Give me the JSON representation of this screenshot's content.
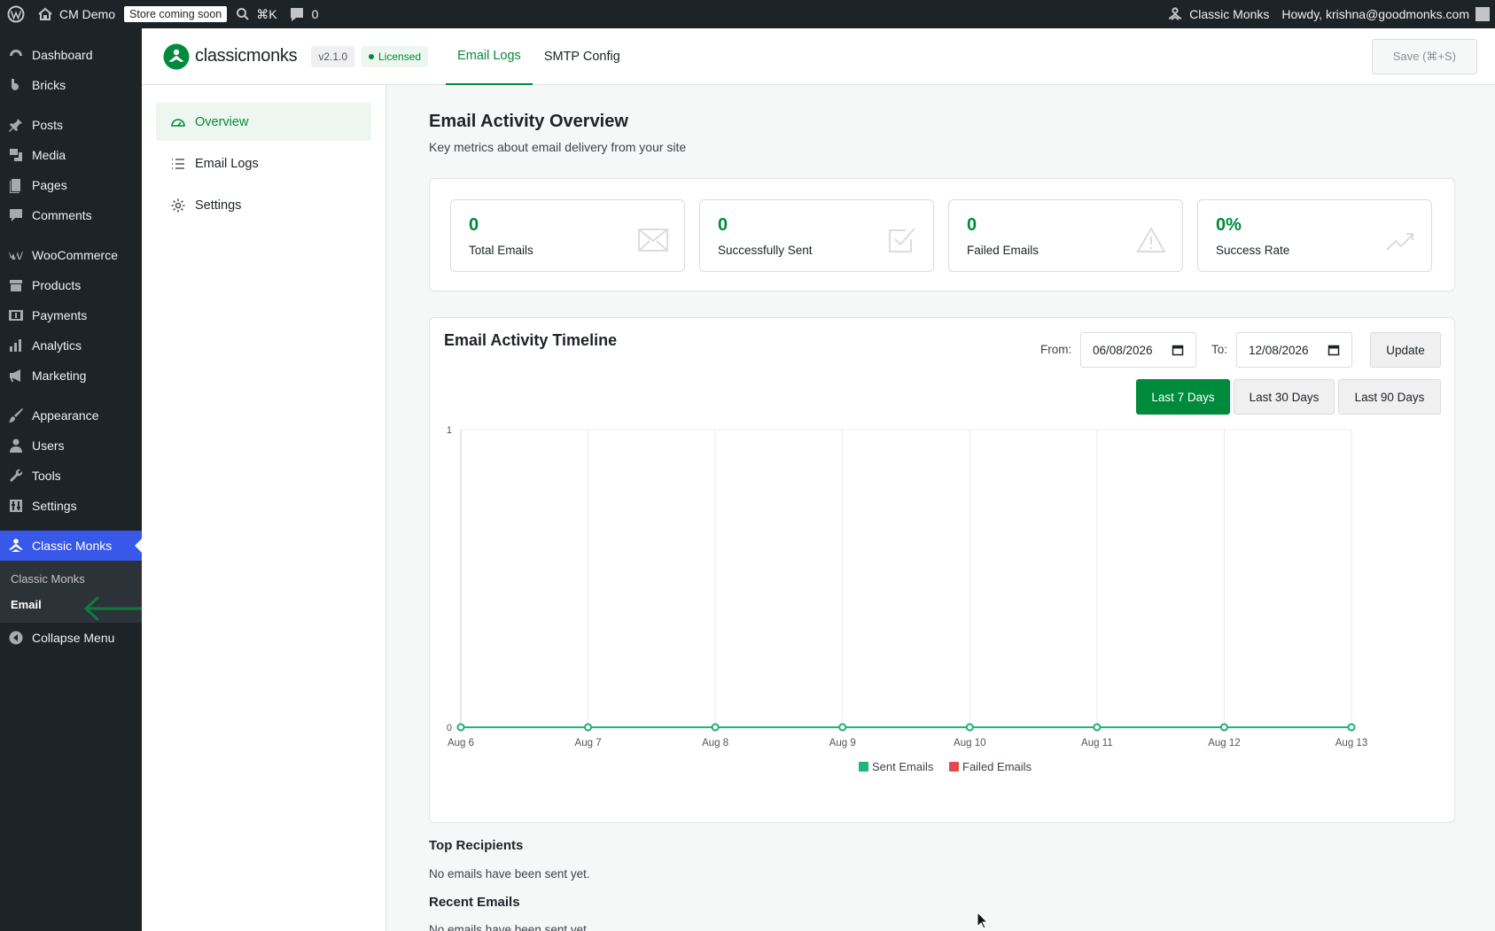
{
  "adminbar": {
    "site_name": "CM Demo",
    "store_badge": "Store coming soon",
    "shortcut": "⌘K",
    "comments_count": "0",
    "plugin_name": "Classic Monks",
    "howdy": "Howdy, krishna@goodmonks.com"
  },
  "sidebar": {
    "items": [
      {
        "label": "Dashboard",
        "icon": "dashboard-icon"
      },
      {
        "label": "Bricks",
        "icon": "bricks-icon"
      },
      {
        "label": "Posts",
        "icon": "pin-icon"
      },
      {
        "label": "Media",
        "icon": "media-icon"
      },
      {
        "label": "Pages",
        "icon": "pages-icon"
      },
      {
        "label": "Comments",
        "icon": "comment-icon"
      },
      {
        "label": "WooCommerce",
        "icon": "woocommerce-icon"
      },
      {
        "label": "Products",
        "icon": "archive-icon"
      },
      {
        "label": "Payments",
        "icon": "payments-icon"
      },
      {
        "label": "Analytics",
        "icon": "bar-chart-icon"
      },
      {
        "label": "Marketing",
        "icon": "megaphone-icon"
      },
      {
        "label": "Appearance",
        "icon": "brush-icon"
      },
      {
        "label": "Users",
        "icon": "user-icon"
      },
      {
        "label": "Tools",
        "icon": "wrench-icon"
      },
      {
        "label": "Settings",
        "icon": "sliders-icon"
      },
      {
        "label": "Classic Monks",
        "icon": "monk-icon"
      }
    ],
    "submenu": [
      "Classic Monks",
      "Email"
    ],
    "collapse": "Collapse Menu"
  },
  "header": {
    "logo_text": "classicmonks",
    "version": "v2.1.0",
    "license": "Licensed",
    "tabs": [
      "Email Logs",
      "SMTP Config"
    ],
    "save": "Save (⌘+S)"
  },
  "subnav": [
    "Overview",
    "Email Logs",
    "Settings"
  ],
  "overview": {
    "title": "Email Activity Overview",
    "subtitle": "Key metrics about email delivery from your site",
    "stats": [
      {
        "value": "0",
        "label": "Total Emails",
        "icon": "envelope-icon"
      },
      {
        "value": "0",
        "label": "Successfully Sent",
        "icon": "checkbox-icon"
      },
      {
        "value": "0",
        "label": "Failed Emails",
        "icon": "warning-icon"
      },
      {
        "value": "0%",
        "label": "Success Rate",
        "icon": "trend-icon"
      }
    ]
  },
  "timeline": {
    "title": "Email Activity Timeline",
    "from_label": "From:",
    "from_value": "06/08/2026",
    "to_label": "To:",
    "to_value": "12/08/2026",
    "update": "Update",
    "ranges": [
      "Last 7 Days",
      "Last 30 Days",
      "Last 90 Days"
    ]
  },
  "chart_data": {
    "type": "line",
    "categories": [
      "Aug 6",
      "Aug 7",
      "Aug 8",
      "Aug 9",
      "Aug 10",
      "Aug 11",
      "Aug 12",
      "Aug 13"
    ],
    "series": [
      {
        "name": "Sent Emails",
        "color": "#1cb57a",
        "values": [
          0,
          0,
          0,
          0,
          0,
          0,
          0,
          0
        ]
      },
      {
        "name": "Failed Emails",
        "color": "#e04b4b",
        "values": [
          0,
          0,
          0,
          0,
          0,
          0,
          0,
          0
        ]
      }
    ],
    "ylim": [
      0,
      1
    ],
    "yticks": [
      "0",
      "1"
    ],
    "grid": true,
    "legend": "bottom-center"
  },
  "sections": {
    "top_recipients": "Top Recipients",
    "top_recipients_empty": "No emails have been sent yet.",
    "recent_emails": "Recent Emails",
    "recent_emails_empty": "No emails have been sent yet."
  },
  "colors": {
    "accent": "#008a3b",
    "wp_dark": "#1d2327",
    "wp_active": "#3858e9"
  }
}
